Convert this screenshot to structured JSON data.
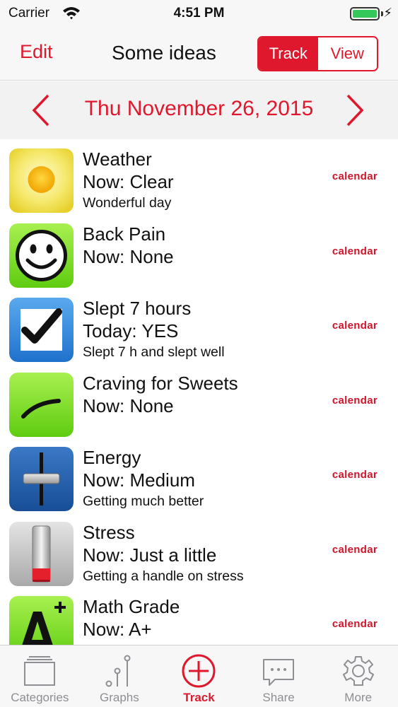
{
  "status_bar": {
    "carrier": "Carrier",
    "time": "4:51 PM"
  },
  "nav": {
    "edit_label": "Edit",
    "title": "Some ideas",
    "segments": {
      "track": "Track",
      "view": "View"
    }
  },
  "date_bar": {
    "date": "Thu November 26, 2015"
  },
  "items": [
    {
      "title": "Weather",
      "status": "Now: Clear",
      "note": "Wonderful day",
      "link": "calendar",
      "icon": "sun-icon"
    },
    {
      "title": "Back Pain",
      "status": "Now: None",
      "note": "",
      "link": "calendar",
      "icon": "smiley-icon"
    },
    {
      "title": "Slept 7 hours",
      "status": "Today: YES",
      "note": "Slept 7 h and slept well",
      "link": "calendar",
      "icon": "checkmark-icon"
    },
    {
      "title": "Craving for Sweets",
      "status": "Now: None",
      "note": "",
      "link": "calendar",
      "icon": "curve-icon"
    },
    {
      "title": "Energy",
      "status": "Now: Medium",
      "note": "Getting much better",
      "link": "calendar",
      "icon": "slider-icon"
    },
    {
      "title": "Stress",
      "status": "Now: Just a little",
      "note": "Getting a handle on stress",
      "link": "calendar",
      "icon": "test-tube-icon"
    },
    {
      "title": "Math Grade",
      "status": "Now: A+",
      "note": "",
      "link": "calendar",
      "icon": "grade-icon"
    }
  ],
  "tabs": [
    {
      "label": "Categories",
      "icon": "categories-icon"
    },
    {
      "label": "Graphs",
      "icon": "graphs-icon"
    },
    {
      "label": "Track",
      "icon": "track-icon"
    },
    {
      "label": "Share",
      "icon": "share-icon"
    },
    {
      "label": "More",
      "icon": "gear-icon"
    }
  ],
  "colors": {
    "accent": "#e0182d",
    "tab_inactive": "#8e8e93"
  }
}
